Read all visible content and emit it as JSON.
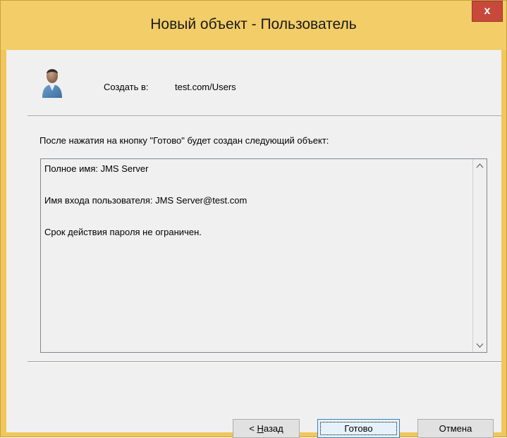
{
  "window": {
    "title": "Новый объект - Пользователь",
    "close_label": "x"
  },
  "header": {
    "icon": "user-icon",
    "create_in_label": "Создать в:",
    "create_in_value": "test.com/Users"
  },
  "info_text": "После нажатия на кнопку \"Готово\" будет создан следующий объект:",
  "summary": {
    "lines": [
      "Полное имя: JMS Server",
      "Имя входа пользователя: JMS Server@test.com",
      "Срок действия пароля не ограничен."
    ]
  },
  "buttons": {
    "back_prefix": "< ",
    "back_accel": "Н",
    "back_rest": "азад",
    "finish": "Готово",
    "cancel": "Отмена"
  },
  "colors": {
    "titlebar": "#f3cd67",
    "close": "#c7493c",
    "client": "#f0f0f0"
  }
}
